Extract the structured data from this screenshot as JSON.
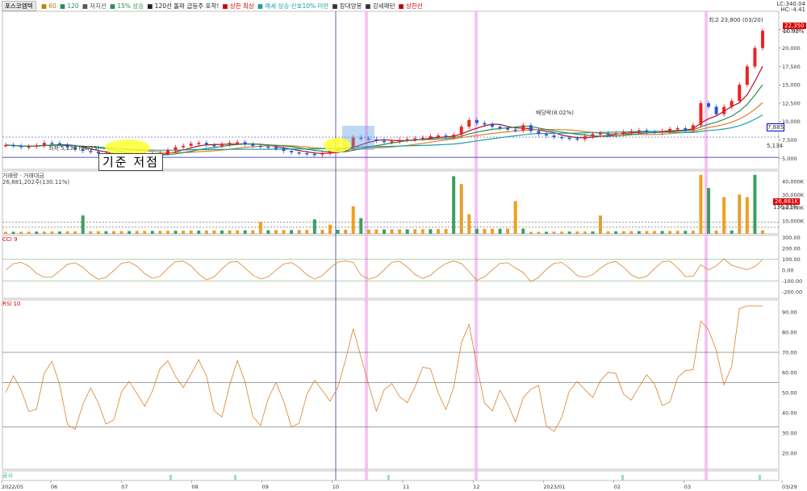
{
  "legend": {
    "title": "포스코엠텍",
    "items": [
      {
        "label": "60",
        "color": "#b8860b"
      },
      {
        "label": "120",
        "color": "#2e8b57"
      },
      {
        "label": "저지선",
        "color": "#555555"
      },
      {
        "label": "15% 상승",
        "color": "#2e8b57"
      },
      {
        "label": "120선 돌파 급등주 포착!",
        "color": "#222222"
      },
      {
        "label": "상한 최상",
        "color": "#d00000"
      },
      {
        "label": "매세 상승·신호10% 미만",
        "color": "#1a9fa0"
      },
      {
        "label": "장대양봉",
        "color": "#333333"
      },
      {
        "label": "강세패턴",
        "color": "#333333"
      },
      {
        "label": "상한선",
        "color": "#c00000"
      }
    ]
  },
  "corner": {
    "lc": "LC:340.04",
    "hc": "HC:-4.41"
  },
  "annotations": {
    "peak_label": "최고 23,800 (03/20)",
    "low_label": "최저 5,130 (06/23)",
    "box_text": "기준 저점",
    "mid_label": "배당락(8.02%)",
    "current_price": "22,350",
    "current_pct": "10.92%",
    "support_tag": "7,885",
    "low_tag": "5,134"
  },
  "panels": {
    "volume": {
      "title": "거래량 · 거래대금",
      "sub": "26,881,202주(130.11%)",
      "tag": "26,881K",
      "tag2": "136.21%"
    },
    "cci": {
      "title": "CCI 9"
    },
    "rsi": {
      "title": "RSI 10"
    },
    "bottom": {
      "title": "공시"
    }
  },
  "chart_data": {
    "type": "line",
    "x_ticks": [
      "2022/05",
      "06",
      "07",
      "08",
      "09",
      "10",
      "11",
      "12",
      "2023/01",
      "02",
      "03",
      "03/29"
    ],
    "price_axis": {
      "ticks": [
        5000,
        7500,
        10000,
        12500,
        15000,
        17500,
        20000,
        22500
      ],
      "labels": [
        "5,000",
        "7,500",
        "10,000",
        "12,500",
        "15,000",
        "17,500",
        "20,000",
        "22,500"
      ],
      "range": [
        3500,
        25000
      ]
    },
    "volume_axis": {
      "ticks": [
        10000,
        20000,
        30000,
        40000
      ],
      "labels": [
        "10,000K",
        "20,000K",
        "30,000K",
        "40,000K"
      ],
      "range": [
        0,
        48000
      ]
    },
    "cci_axis": {
      "ticks": [
        -200,
        -100,
        0,
        100,
        200,
        300
      ],
      "labels": [
        "-200.00",
        "-100.00",
        "0.00",
        "100.00",
        "200.00",
        "300.00"
      ],
      "range": [
        -260,
        320
      ]
    },
    "rsi_axis": {
      "ticks": [
        20,
        30,
        40,
        50,
        60,
        70,
        80,
        90
      ],
      "labels": [
        "20.00",
        "30.00",
        "40.00",
        "50.00",
        "60.00",
        "70.00",
        "80.00",
        "90.00"
      ],
      "range": [
        12,
        96
      ]
    },
    "series": [
      {
        "name": "price",
        "values": [
          6800,
          6700,
          6500,
          6600,
          6750,
          7100,
          7050,
          6800,
          6500,
          6200,
          6000,
          5900,
          5700,
          5500,
          5300,
          5250,
          5200,
          5350,
          5500,
          5600,
          5700,
          6100,
          6500,
          6700,
          7000,
          7100,
          6800,
          6700,
          6900,
          7100,
          7200,
          6900,
          6700,
          6600,
          6500,
          6300,
          6000,
          5800,
          5700,
          5600,
          5500,
          5700,
          6000,
          6200,
          6500,
          7800,
          7700,
          7600,
          7400,
          7200,
          7300,
          7500,
          7600,
          7700,
          7800,
          8000,
          8100,
          7900,
          8200,
          9300,
          10200,
          9800,
          9600,
          9300,
          9100,
          8900,
          8800,
          9500,
          8700,
          8300,
          8100,
          7900,
          7800,
          7700,
          7600,
          8000,
          8300,
          8400,
          8200,
          8400,
          8600,
          8700,
          8800,
          8600,
          8500,
          8700,
          9000,
          9100,
          8800,
          9500,
          12500,
          12000,
          11000,
          12000,
          12800,
          15000,
          17500,
          20000,
          22350
        ]
      }
    ]
  }
}
